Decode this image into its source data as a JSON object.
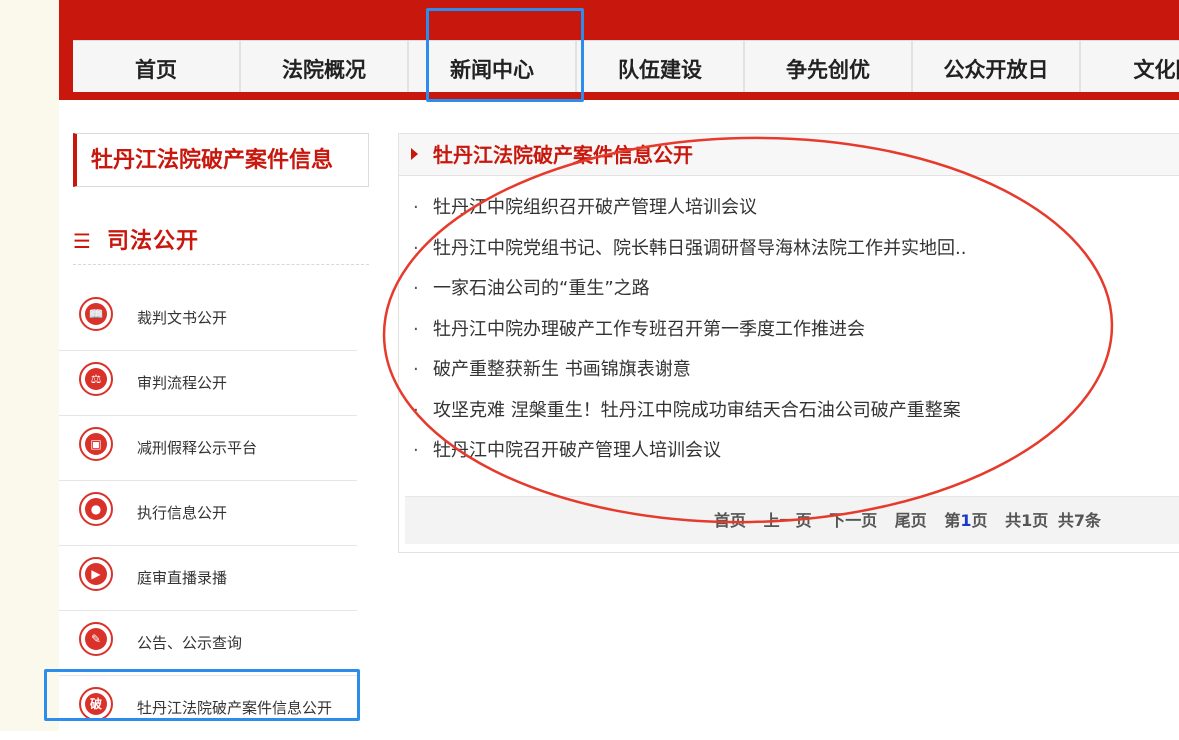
{
  "colors": {
    "brand_red": "#c8170d",
    "highlight_blue": "#2c8ded",
    "annotation_red": "#e53a2c"
  },
  "nav": {
    "items": [
      {
        "label": "首页"
      },
      {
        "label": "法院概况"
      },
      {
        "label": "新闻中心"
      },
      {
        "label": "队伍建设"
      },
      {
        "label": "争先创优"
      },
      {
        "label": "公众开放日"
      },
      {
        "label": "文化园"
      }
    ]
  },
  "sidebar": {
    "title": "牡丹江法院破产案件信息",
    "category_icon": "list-icon",
    "category": "司法公开",
    "items": [
      {
        "icon": "book-icon",
        "glyph": "📖",
        "label": "裁判文书公开"
      },
      {
        "icon": "gavel-icon",
        "glyph": "⚖",
        "label": "审判流程公开"
      },
      {
        "icon": "briefcase-icon",
        "glyph": "▣",
        "label": "减刑假释公示平台"
      },
      {
        "icon": "person-icon",
        "glyph": "●",
        "label": "执行信息公开"
      },
      {
        "icon": "camera-icon",
        "glyph": "▶",
        "label": "庭审直播录播"
      },
      {
        "icon": "notice-icon",
        "glyph": "✎",
        "label": "公告、公示查询"
      },
      {
        "icon": "bankruptcy-icon",
        "glyph": "破",
        "label": "牡丹江法院破产案件信息公开"
      }
    ]
  },
  "main": {
    "title": "牡丹江法院破产案件信息公开",
    "news": [
      {
        "bullet": "·",
        "title": "牡丹江中院组织召开破产管理人培训会议"
      },
      {
        "bullet": "·",
        "title": "牡丹江中院党组书记、院长韩日强调研督导海林法院工作并实地回.."
      },
      {
        "bullet": "·",
        "title": "一家石油公司的“重生”之路"
      },
      {
        "bullet": "·",
        "title": "牡丹江中院办理破产工作专班召开第一季度工作推进会"
      },
      {
        "bullet": "·",
        "title": "破产重整获新生 书画锦旗表谢意"
      },
      {
        "bullet": "·",
        "title": "攻坚克难 涅槃重生！牡丹江中院成功审结天合石油公司破产重整案"
      },
      {
        "bullet": "·",
        "title": "牡丹江中院召开破产管理人培训会议"
      }
    ],
    "pager": {
      "first": "首页",
      "prev": "上一页",
      "next": "下一页",
      "last": "尾页",
      "page_prefix": "第",
      "page_current": "1",
      "page_suffix": "页",
      "total_pages": "共1页",
      "total_items": "共7条"
    }
  }
}
